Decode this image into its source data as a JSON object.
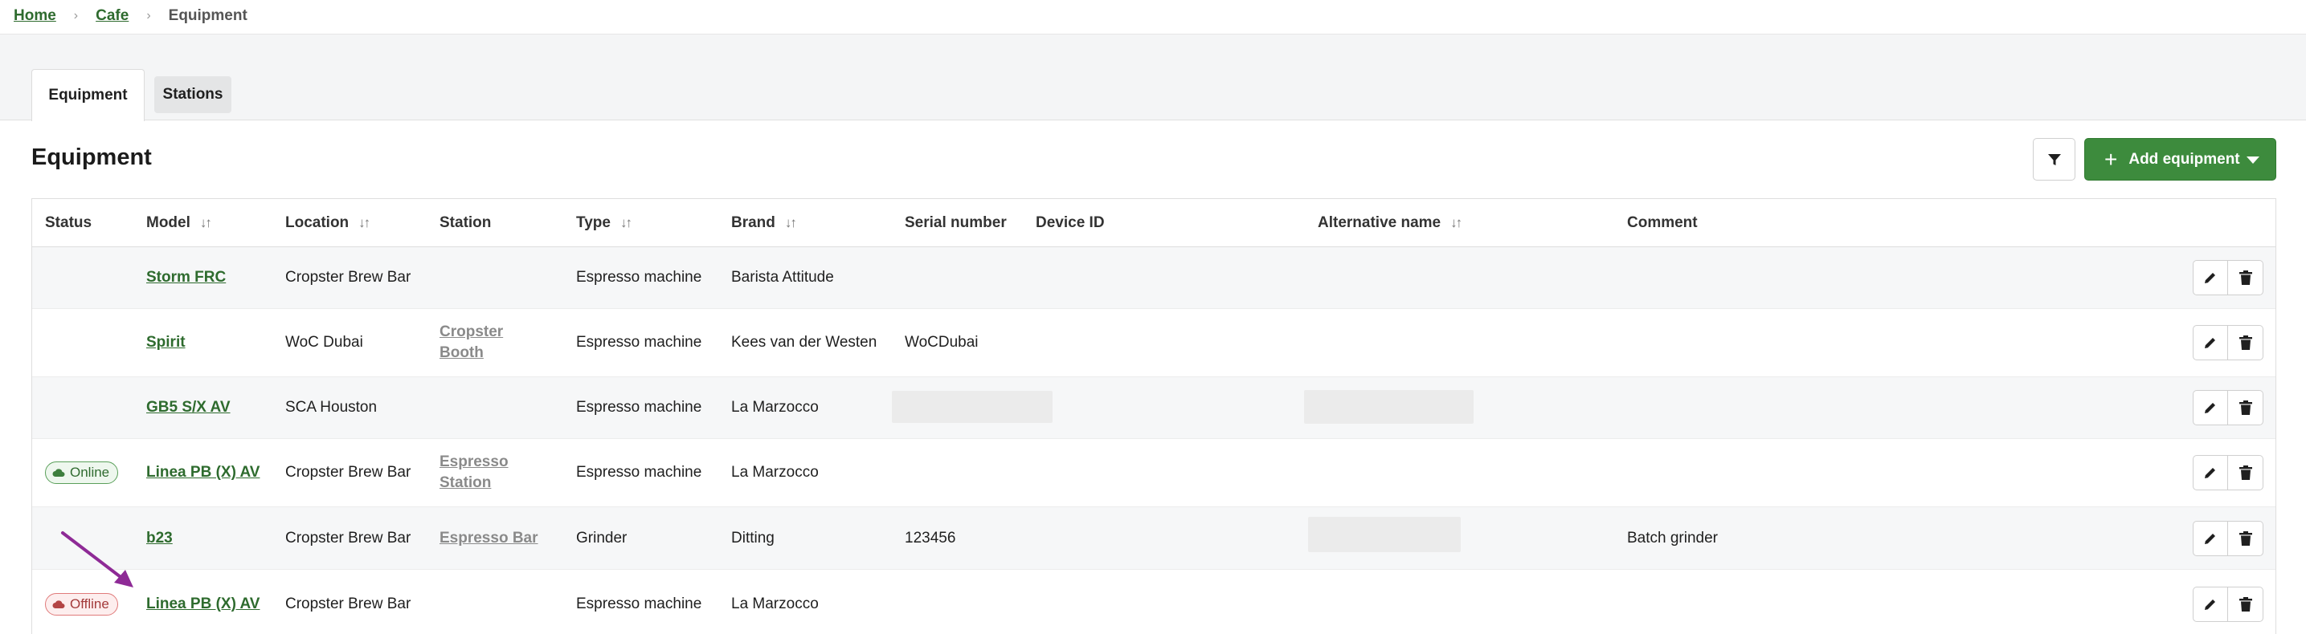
{
  "breadcrumb": {
    "home": "Home",
    "cafe": "Cafe",
    "current": "Equipment"
  },
  "tabs": [
    {
      "label": "Equipment"
    },
    {
      "label": "Stations"
    }
  ],
  "page_title": "Equipment",
  "toolbar": {
    "add_label": "Add equipment",
    "filter_icon": "filter-icon"
  },
  "columns": {
    "status": "Status",
    "model": "Model",
    "location": "Location",
    "station": "Station",
    "type": "Type",
    "brand": "Brand",
    "serial": "Serial number",
    "device": "Device ID",
    "alt_name": "Alternative name",
    "comment": "Comment"
  },
  "rows": [
    {
      "status": "",
      "model": "Storm FRC",
      "location": "Cropster Brew Bar",
      "station": "",
      "type": "Espresso machine",
      "brand": "Barista Attitude",
      "serial": "",
      "device": "",
      "alt_name": "",
      "comment": ""
    },
    {
      "status": "",
      "model": "Spirit",
      "location": "WoC Dubai",
      "station": "Cropster Booth",
      "type": "Espresso machine",
      "brand": "Kees van der Westen",
      "serial": "WoCDubai",
      "device": "",
      "alt_name": "",
      "comment": ""
    },
    {
      "status": "",
      "model": "GB5 S/X AV",
      "location": "SCA Houston",
      "station": "",
      "type": "Espresso machine",
      "brand": "La Marzocco",
      "serial": "",
      "device": "",
      "alt_name": "",
      "comment": ""
    },
    {
      "status": "Online",
      "model": "Linea PB (X) AV",
      "location": "Cropster Brew Bar",
      "station": "Espresso Station",
      "type": "Espresso machine",
      "brand": "La Marzocco",
      "serial": "",
      "device": "",
      "alt_name": "",
      "comment": ""
    },
    {
      "status": "",
      "model": "b23",
      "location": "Cropster Brew Bar",
      "station": "Espresso Bar",
      "type": "Grinder",
      "brand": "Ditting",
      "serial": "123456",
      "device": "",
      "alt_name": "",
      "comment": "Batch grinder"
    },
    {
      "status": "Offline",
      "model": "Linea PB (X) AV",
      "location": "Cropster Brew Bar",
      "station": "",
      "type": "Espresso machine",
      "brand": "La Marzocco",
      "serial": "",
      "device": "",
      "alt_name": "",
      "comment": ""
    }
  ],
  "colors": {
    "accent": "#3d8b3d",
    "link": "#2e6b2e",
    "online": "#5aa05a",
    "offline": "#e07a7a",
    "annotation_arrow": "#8e2a96"
  }
}
